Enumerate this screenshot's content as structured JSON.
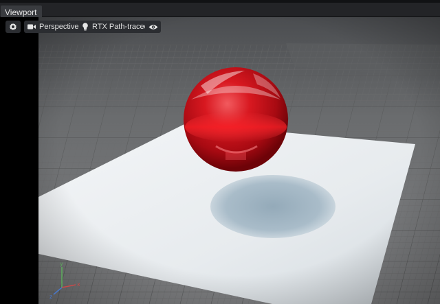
{
  "tab": {
    "title": "Viewport"
  },
  "toolbar": {
    "settings_icon": "gear-icon",
    "camera": {
      "icon": "video-camera-icon",
      "label": "Perspective"
    },
    "renderer": {
      "icon": "lightbulb-icon",
      "label": "RTX Path-traced"
    },
    "visibility_icon": "eye-icon"
  },
  "gizmo": {
    "x_label": "x",
    "y_label": "y",
    "z_label": "z"
  },
  "colors": {
    "axis_x": "#c94a4a",
    "axis_y": "#5cae5c",
    "axis_z": "#4a78c9",
    "sphere": "#cc0f18",
    "plane": "#e9edf0",
    "shadow": "#9fb3c2",
    "ground": "#8a8b8c"
  }
}
